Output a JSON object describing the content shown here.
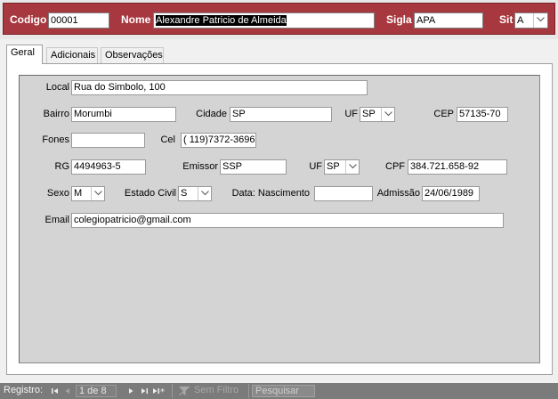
{
  "header": {
    "codigo_label": "Codigo",
    "codigo_value": "00001",
    "nome_label": "Nome",
    "nome_value": "Alexandre Patricio de Almeida",
    "sigla_label": "Sigla",
    "sigla_value": "APA",
    "sit_label": "Sit",
    "sit_value": "A"
  },
  "tabs": [
    {
      "label": "Geral",
      "active": true
    },
    {
      "label": "Adicionais",
      "active": false
    },
    {
      "label": "Observações",
      "active": false
    }
  ],
  "form": {
    "local_label": "Local",
    "local_value": "Rua do Simbolo, 100",
    "bairro_label": "Bairro",
    "bairro_value": "Morumbi",
    "cidade_label": "Cidade",
    "cidade_value": "SP",
    "uf1_label": "UF",
    "uf1_value": "SP",
    "cep_label": "CEP",
    "cep_value": "57135-70",
    "fones_label": "Fones",
    "fones_value": "",
    "cel_label": "Cel",
    "cel_value": "( 119)7372-3696",
    "rg_label": "RG",
    "rg_value": "4494963-5",
    "emissor_label": "Emissor",
    "emissor_value": "SSP",
    "uf2_label": "UF",
    "uf2_value": "SP",
    "cpf_label": "CPF",
    "cpf_value": "384.721.658-92",
    "sexo_label": "Sexo",
    "sexo_value": "M",
    "estado_civil_label": "Estado Civil",
    "estado_civil_value": "S",
    "nascimento_label": "Data: Nascimento",
    "nascimento_value": "",
    "admissao_label": "Admissão",
    "admissao_value": "24/06/1989",
    "email_label": "Email",
    "email_value": "colegiopatricio@gmail.com"
  },
  "navbar": {
    "registro_label": "Registro:",
    "record_position": "1 de 8",
    "filter_label": "Sem Filtro",
    "search_placeholder": "Pesquisar"
  },
  "colors": {
    "header_bg": "#a8383f",
    "panel_bg": "#d4d4d4",
    "navbar_bg": "#7b7b7b"
  }
}
